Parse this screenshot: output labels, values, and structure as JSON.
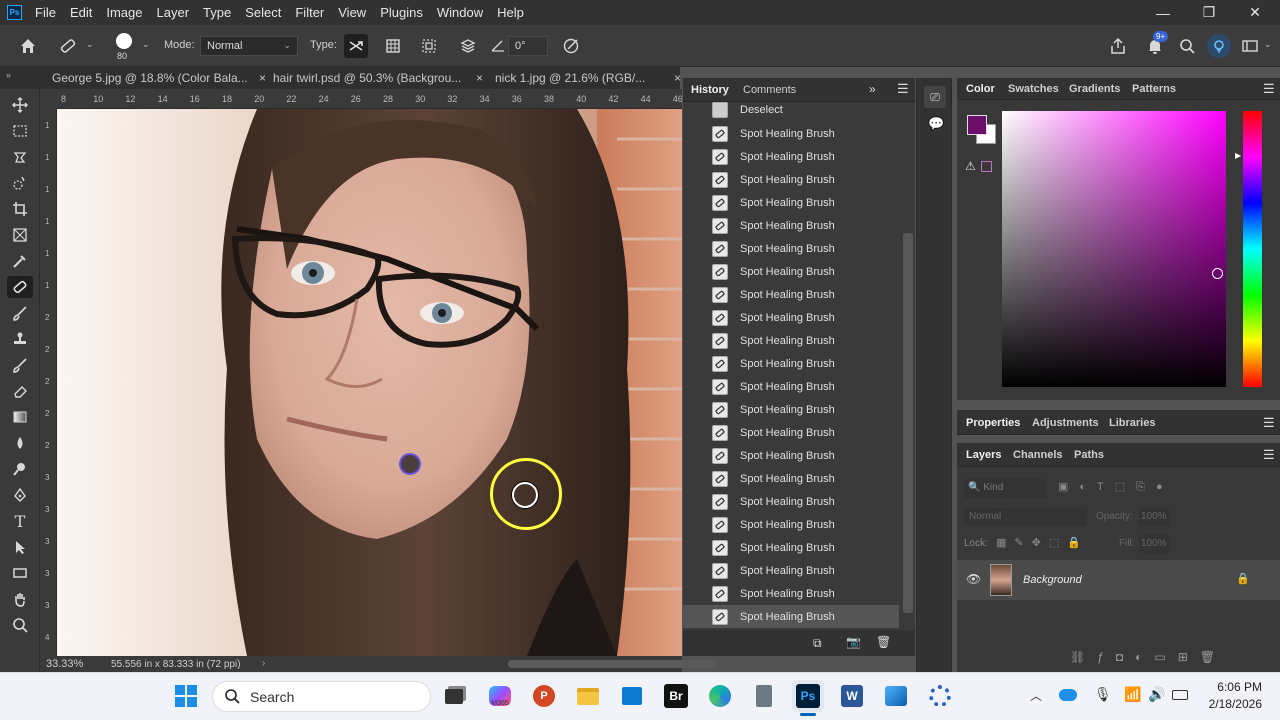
{
  "app": {
    "logo": "Ps"
  },
  "menu": [
    "File",
    "Edit",
    "Image",
    "Layer",
    "Type",
    "Select",
    "Filter",
    "View",
    "Plugins",
    "Window",
    "Help"
  ],
  "window_controls": {
    "minimize": "—",
    "restore": "❐",
    "close": "✕"
  },
  "options_bar": {
    "brush_size": "80",
    "mode_label": "Mode:",
    "mode_value": "Normal",
    "type_label": "Type:",
    "angle_value": "0°",
    "notifications_badge": "9+"
  },
  "doc_tabs": [
    {
      "label": "George 5.jpg @ 18.8% (Color Bala...",
      "close": "×"
    },
    {
      "label": "hair twirl.psd @ 50.3% (Backgrou...",
      "close": "×"
    },
    {
      "label": "nick 1.jpg @ 21.6% (RGB/...",
      "close": "×"
    }
  ],
  "ruler": {
    "h_ticks": [
      "8",
      "10",
      "12",
      "14",
      "16",
      "18",
      "20",
      "22",
      "24",
      "26",
      "28",
      "30",
      "32",
      "34",
      "36",
      "38",
      "40",
      "42",
      "44",
      "46"
    ],
    "v_ticks": [
      "1",
      "1",
      "1",
      "1",
      "1",
      "1",
      "2",
      "2",
      "2",
      "2",
      "2",
      "3",
      "3",
      "3",
      "3",
      "3",
      "4"
    ]
  },
  "status": {
    "zoom": "33.33%",
    "doc_info": "55.556 in x 83.333 in (72 ppi)"
  },
  "history": {
    "tabs": [
      "History",
      "Comments"
    ],
    "first_item": "Deselect",
    "items": [
      "Spot Healing Brush",
      "Spot Healing Brush",
      "Spot Healing Brush",
      "Spot Healing Brush",
      "Spot Healing Brush",
      "Spot Healing Brush",
      "Spot Healing Brush",
      "Spot Healing Brush",
      "Spot Healing Brush",
      "Spot Healing Brush",
      "Spot Healing Brush",
      "Spot Healing Brush",
      "Spot Healing Brush",
      "Spot Healing Brush",
      "Spot Healing Brush",
      "Spot Healing Brush",
      "Spot Healing Brush",
      "Spot Healing Brush",
      "Spot Healing Brush",
      "Spot Healing Brush",
      "Spot Healing Brush",
      "Spot Healing Brush"
    ]
  },
  "color_panel": {
    "tabs": [
      "Color",
      "Swatches",
      "Gradients",
      "Patterns"
    ],
    "foreground_color": "#6b0f6b",
    "background_color": "#ffffff"
  },
  "properties_panel": {
    "tabs": [
      "Properties",
      "Adjustments",
      "Libraries"
    ]
  },
  "layers_panel": {
    "tabs": [
      "Layers",
      "Channels",
      "Paths"
    ],
    "kind_placeholder": "Kind",
    "blend_mode": "Normal",
    "opacity_label": "Opacity:",
    "opacity_value": "100%",
    "lock_label": "Lock:",
    "fill_label": "Fill:",
    "fill_value": "100%",
    "layer_name": "Background"
  },
  "taskbar": {
    "search_label": "Search",
    "time": "6:06 PM",
    "date": "2/18/2026",
    "br_label": "Br",
    "ps_label": "Ps",
    "m365_label": "M365"
  }
}
